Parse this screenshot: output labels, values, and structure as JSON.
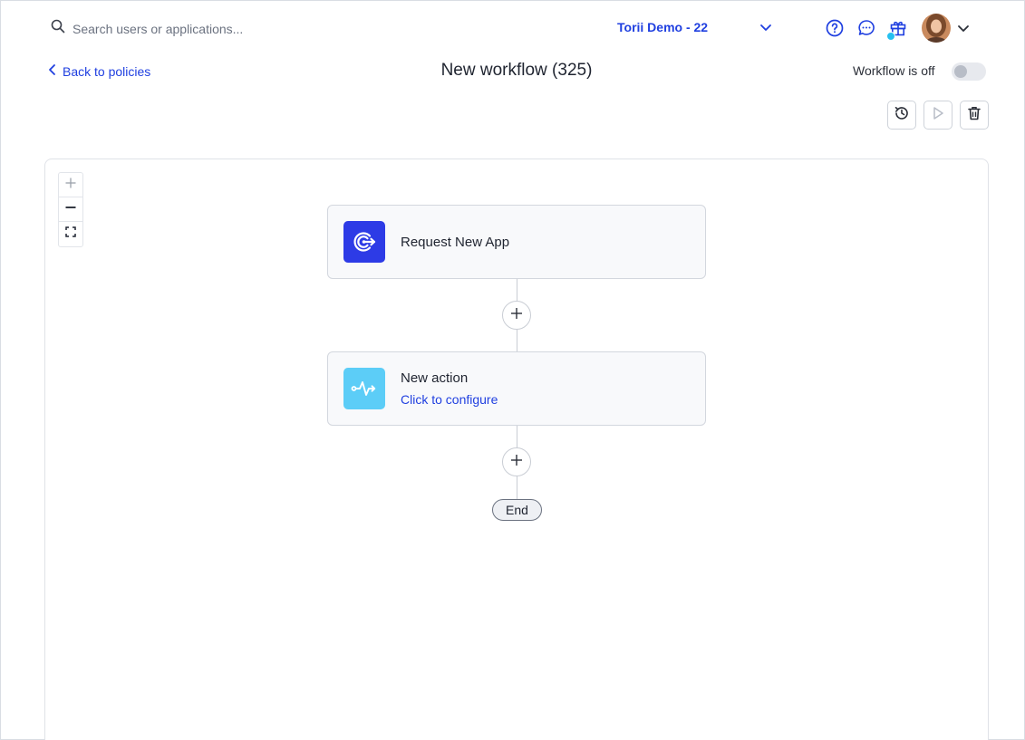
{
  "topbar": {
    "search_placeholder": "Search users or applications...",
    "org_name": "Torii Demo - 22"
  },
  "header": {
    "back_label": "Back to policies",
    "title": "New workflow (325)",
    "status_label": "Workflow is off",
    "workflow_enabled": false
  },
  "canvas": {
    "trigger": {
      "title": "Request New App"
    },
    "action": {
      "title": "New action",
      "subtitle": "Click to configure"
    },
    "end_label": "End"
  },
  "colors": {
    "accent": "#1f3fe0",
    "trigger_icon_bg": "#2d3be6",
    "action_icon_bg": "#5ccdf7",
    "notification_dot": "#26c0f0"
  },
  "icons": {
    "search": "search-icon",
    "help": "help-circle-icon",
    "chat": "chat-icon",
    "gift": "gift-icon",
    "history": "history-icon",
    "play": "play-icon",
    "trash": "trash-icon",
    "zoom_in": "plus-icon",
    "zoom_out": "minus-icon",
    "fit": "fit-screen-icon"
  }
}
